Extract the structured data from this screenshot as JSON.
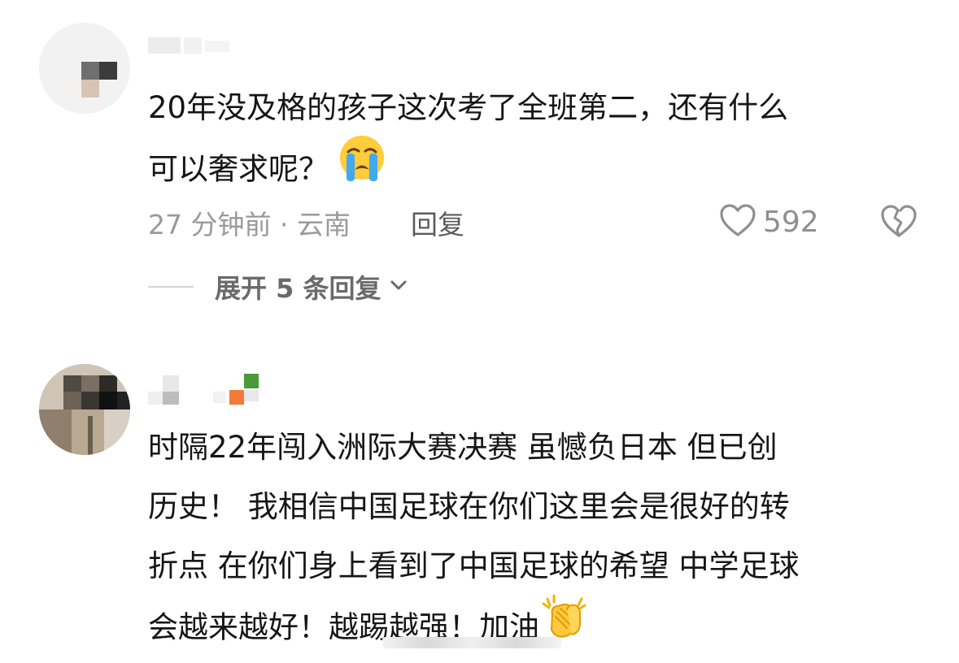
{
  "comments": [
    {
      "text_lines": [
        "20年没及格的孩子这次考了全班第二，还有什么",
        "可以奢求呢？"
      ],
      "emoji": "crying-face",
      "meta": "27 分钟前 · 云南",
      "reply_label": "回复",
      "likes": "592",
      "expand_label": "展开 5 条回复"
    },
    {
      "text_lines": [
        "时隔22年闯入洲际大赛决赛 虽憾负日本 但已创",
        "历史！ 我相信中国足球在你们这里会是很好的转",
        "折点 在你们身上看到了中国足球的希望 中学足球",
        "会越来越好！越踢越强！加油"
      ],
      "emoji": "clapping-hands"
    }
  ],
  "colors": {
    "text": "#161616",
    "meta": "#9a9a9a",
    "reply": "#5b5b5b",
    "icon": "#8f8f8f"
  }
}
